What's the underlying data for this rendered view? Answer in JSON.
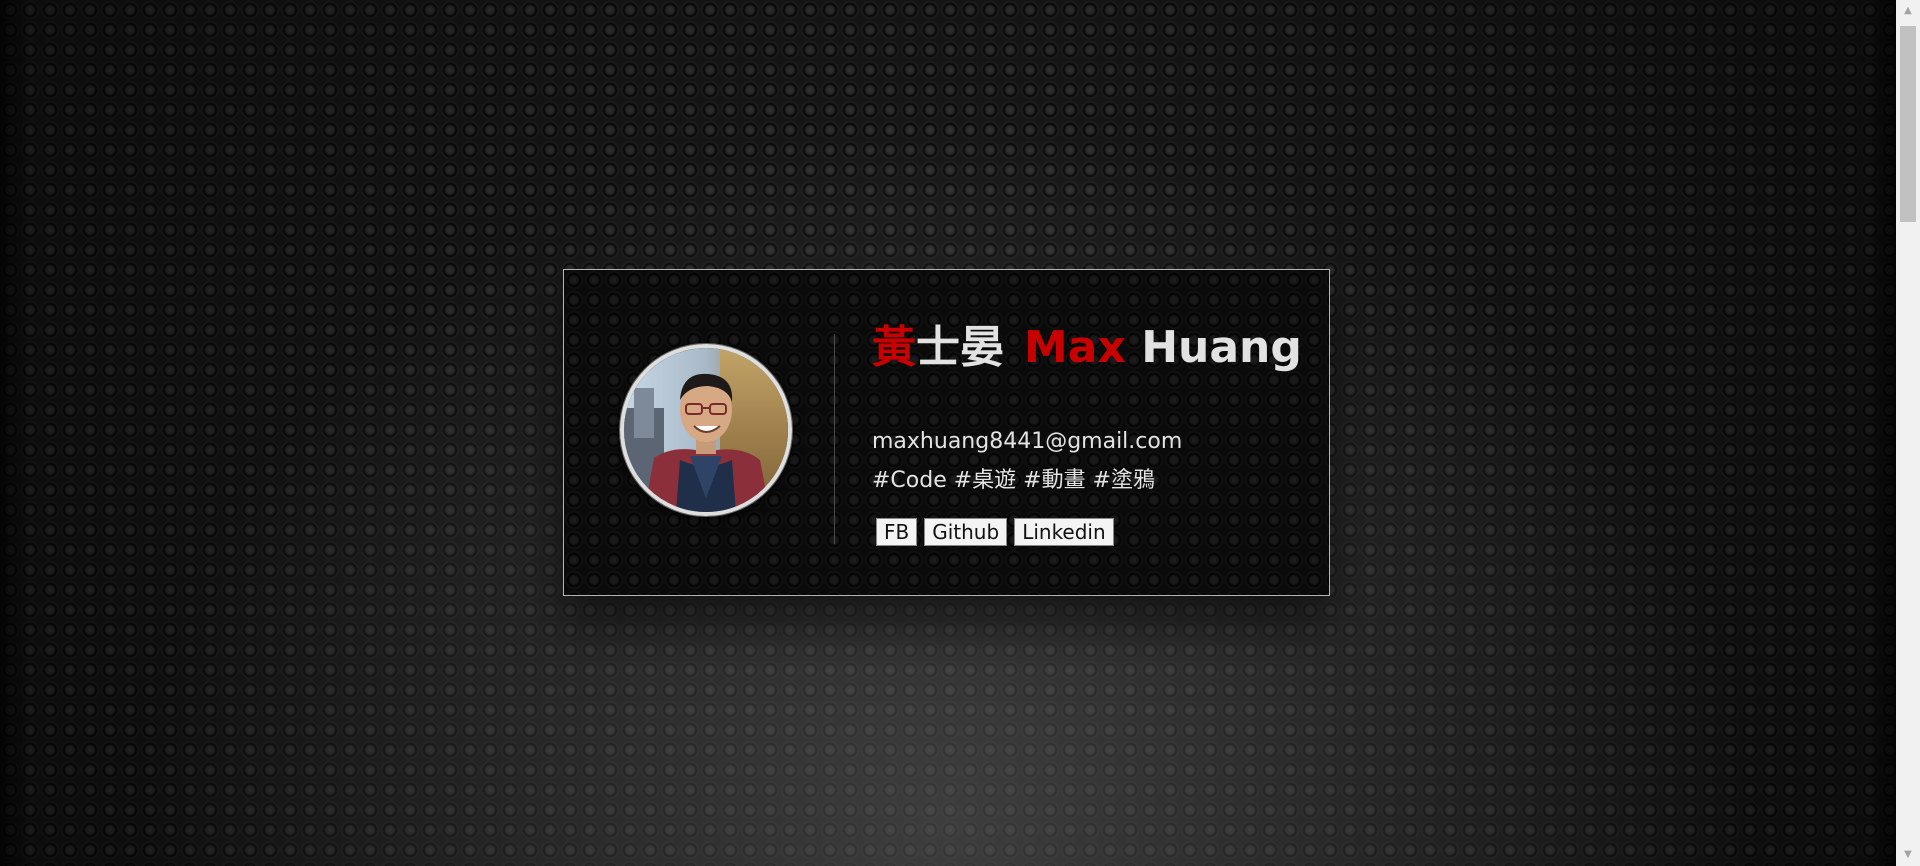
{
  "profile": {
    "name_cn_first": "黃",
    "name_cn_rest": "士晏",
    "name_en_first": "Max",
    "name_en_last": "Huang",
    "email": "maxhuang8441@gmail.com",
    "tags": "#Code #桌遊 #動畫 #塗鴉",
    "avatar_alt": "profile photo"
  },
  "links": [
    {
      "label": "FB"
    },
    {
      "label": "Github"
    },
    {
      "label": "Linkedin"
    }
  ],
  "colors": {
    "accent_red": "#c80000",
    "text_light": "#e2e2e2",
    "card_border": "#b5b5b5"
  },
  "icons": {
    "scroll_up": "triangle-up",
    "scroll_down": "triangle-down"
  }
}
